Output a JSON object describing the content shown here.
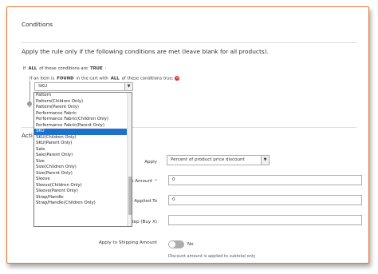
{
  "conditions": {
    "title": "Conditions",
    "heading": "Apply the rule only if the following conditions are met (leave blank for all products).",
    "line1": {
      "prefix": "If",
      "all": "ALL",
      "mid": "of these conditions are",
      "true": "TRUE",
      "suffix": ":"
    },
    "line2": {
      "prefix": "If an item is",
      "found": "FOUND",
      "mid": "in the cart with",
      "all": "ALL",
      "suffix": "of these conditions true:"
    },
    "remove_icon": "x-circle-icon",
    "attribute_select": {
      "value": "SKU",
      "arrow": "▼"
    },
    "dropdown_items": [
      {
        "label": "Pattern",
        "selected": false
      },
      {
        "label": "Pattern(Children Only)",
        "selected": false
      },
      {
        "label": "Pattern(Parent Only)",
        "selected": false
      },
      {
        "label": "Performance Fabric",
        "selected": false
      },
      {
        "label": "Performance Fabric(Children Only)",
        "selected": false
      },
      {
        "label": "Performance Fabric(Parent Only)",
        "selected": false
      },
      {
        "label": "SKU",
        "selected": true
      },
      {
        "label": "SKU(Children Only)",
        "selected": false
      },
      {
        "label": "SKU(Parent Only)",
        "selected": false
      },
      {
        "label": "Sale",
        "selected": false
      },
      {
        "label": "Sale(Parent Only)",
        "selected": false
      },
      {
        "label": "Size",
        "selected": false
      },
      {
        "label": "Size(Children Only)",
        "selected": false
      },
      {
        "label": "Size(Parent Only)",
        "selected": false
      },
      {
        "label": "Sleeve",
        "selected": false
      },
      {
        "label": "Sleeve(Children Only)",
        "selected": false
      },
      {
        "label": "Sleeve(Parent Only)",
        "selected": false
      },
      {
        "label": "Strap/Handle",
        "selected": false
      },
      {
        "label": "Strap/Handle(Children Only)",
        "selected": false
      }
    ],
    "selected_color": "#1f6fcc"
  },
  "actions": {
    "title_partial": "Acti",
    "apply_label": "Apply",
    "apply_value": "Percent of product price discount",
    "amount_label": "unt Amount",
    "amount_value": "0",
    "apply_to_label": "s Applied To",
    "apply_to_value": "0",
    "step_label": "Step (Buy X)",
    "step_value": "",
    "shipping_label": "Apply to Shipping Amount",
    "shipping_toggle": "No",
    "shipping_note": "Discount amount is applied to subtotal only",
    "required_marker": "*"
  },
  "accent_color": "#e07a38"
}
